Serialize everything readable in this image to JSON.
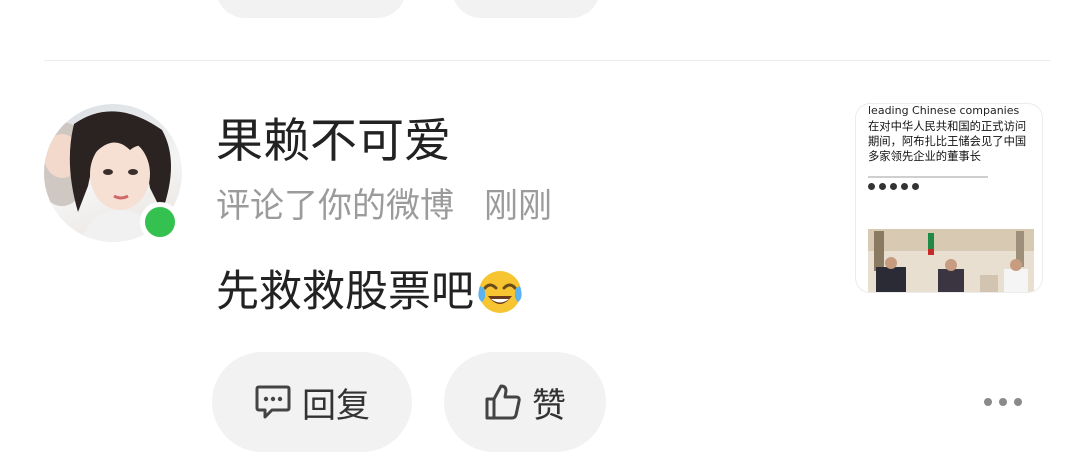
{
  "previous_item": {
    "visible": true
  },
  "notification": {
    "user": {
      "name": "果赖不可爱",
      "online": true
    },
    "action": "评论了你的微博",
    "time": "刚刚",
    "comment_text": "先救救股票吧",
    "comment_emoji": "laughing-crying-emoji"
  },
  "actions": {
    "reply_label": "回复",
    "like_label": "赞",
    "reply_icon": "comment-icon",
    "like_icon": "thumbs-up-icon",
    "more_icon": "more-dots-icon"
  },
  "post_preview": {
    "title": "leading Chinese companies",
    "body": "在对中华人民共和国的正式访问期间，阿布扎比王储会见了中国多家领先企业的董事长"
  },
  "colors": {
    "online": "#35c150",
    "secondary_text": "#9b9b9b",
    "button_bg": "#f2f2f2",
    "emoji_yellow": "#f7c531"
  }
}
